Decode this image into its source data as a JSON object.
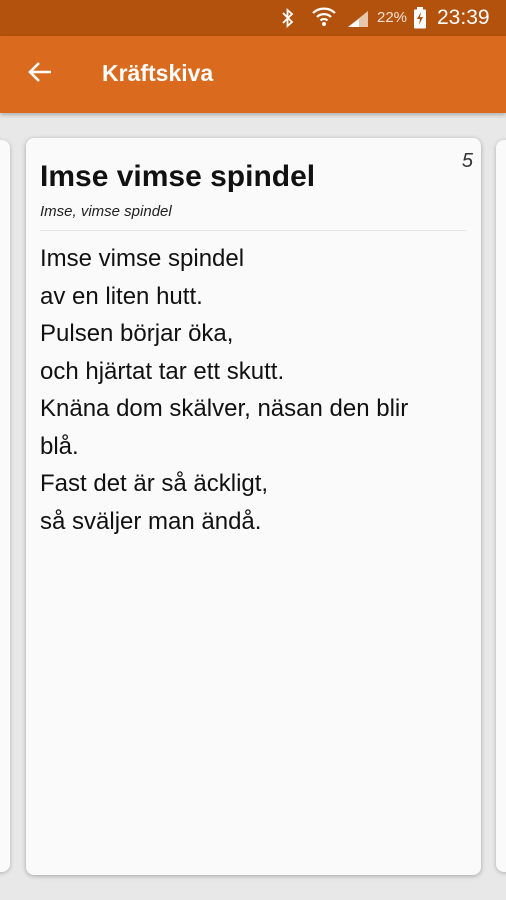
{
  "status_bar": {
    "icons": [
      "bluetooth-icon",
      "wifi-icon",
      "signal-icon",
      "battery-charging-icon"
    ],
    "battery_percent": "22%",
    "time": "23:39"
  },
  "app_bar": {
    "back_icon": "arrow-left-icon",
    "title": "Kräftskiva",
    "color": "#d96a1e",
    "status_color": "#b3520c"
  },
  "song": {
    "number": "5",
    "title": "Imse vimse spindel",
    "melody": "Imse, vimse spindel",
    "lyrics": [
      "Imse vimse spindel",
      "av en liten hutt.",
      "Pulsen börjar öka,",
      "och hjärtat tar ett skutt.",
      "Knäna dom skälver, näsan den blir",
      "blå.",
      "Fast det är så äckligt,",
      "så sväljer man ändå."
    ]
  }
}
